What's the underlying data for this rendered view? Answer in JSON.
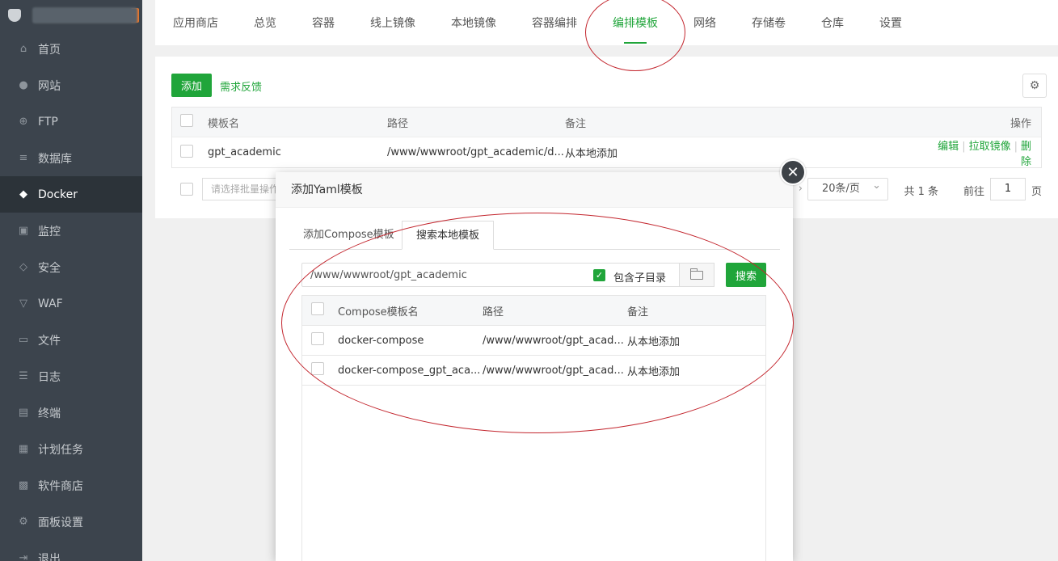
{
  "sidebar": {
    "items": [
      {
        "label": "首页",
        "icon": "home-icon"
      },
      {
        "label": "网站",
        "icon": "globe-icon"
      },
      {
        "label": "FTP",
        "icon": "ftp-globe-icon"
      },
      {
        "label": "数据库",
        "icon": "database-icon"
      },
      {
        "label": "Docker",
        "icon": "docker-icon",
        "active": true
      },
      {
        "label": "监控",
        "icon": "monitor-icon"
      },
      {
        "label": "安全",
        "icon": "shield-icon"
      },
      {
        "label": "WAF",
        "icon": "waf-shield-icon"
      },
      {
        "label": "文件",
        "icon": "folder-icon"
      },
      {
        "label": "日志",
        "icon": "log-icon"
      },
      {
        "label": "终端",
        "icon": "terminal-icon"
      },
      {
        "label": "计划任务",
        "icon": "calendar-icon"
      },
      {
        "label": "软件商店",
        "icon": "apps-icon"
      },
      {
        "label": "面板设置",
        "icon": "settings-icon"
      },
      {
        "label": "退出",
        "icon": "logout-icon"
      }
    ]
  },
  "topbar": {
    "tabs": [
      "应用商店",
      "总览",
      "容器",
      "线上镜像",
      "本地镜像",
      "容器编排",
      "编排模板",
      "网络",
      "存储卷",
      "仓库",
      "设置"
    ],
    "active_index": 6
  },
  "main": {
    "add_label": "添加",
    "feedback_label": "需求反馈",
    "table": {
      "headers": [
        "模板名",
        "路径",
        "备注",
        "操作"
      ],
      "rows": [
        {
          "name": "gpt_academic",
          "path": "/www/wwwroot/gpt_academic/d...",
          "note": "从本地添加",
          "actions": [
            "编辑",
            "拉取镜像",
            "删除"
          ]
        }
      ]
    },
    "pager": {
      "batch_placeholder": "请选择批量操作",
      "per_page": "20条/页",
      "total": "共 1 条",
      "goto_label": "前往",
      "page": "1",
      "page_unit": "页"
    }
  },
  "modal": {
    "title": "添加Yaml模板",
    "tabs": [
      "添加Compose模板",
      "搜索本地模板"
    ],
    "active_tab": 1,
    "path_value": "/www/wwwroot/gpt_academic",
    "include_subdir_label": "包含子目录",
    "search_label": "搜索",
    "table": {
      "headers": [
        "Compose模板名",
        "路径",
        "备注"
      ],
      "rows": [
        {
          "name": "docker-compose",
          "path": "/www/wwwroot/gpt_acad...",
          "note": "从本地添加"
        },
        {
          "name": "docker-compose_gpt_aca...",
          "path": "/www/wwwroot/gpt_acad...",
          "note": "从本地添加"
        }
      ]
    }
  },
  "colors": {
    "accent": "#20a53a",
    "sidebar_bg": "#3c444d",
    "annotation": "#c3262e"
  }
}
